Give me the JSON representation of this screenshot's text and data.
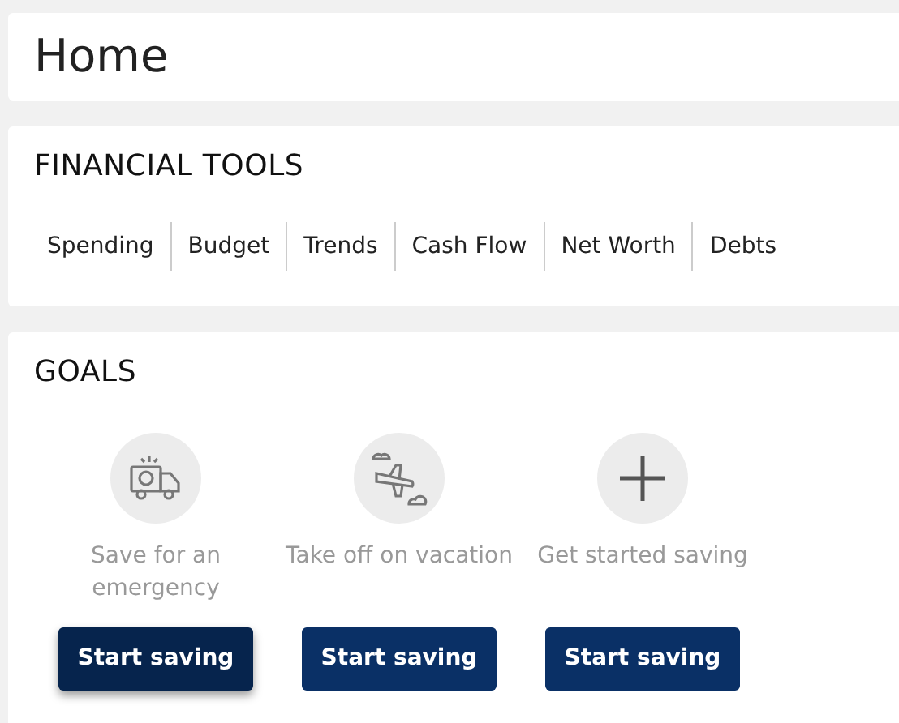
{
  "page_title": "Home",
  "financial_tools": {
    "title": "FINANCIAL TOOLS",
    "links": [
      {
        "label": "Spending"
      },
      {
        "label": "Budget"
      },
      {
        "label": "Trends"
      },
      {
        "label": "Cash Flow"
      },
      {
        "label": "Net Worth"
      },
      {
        "label": "Debts"
      }
    ]
  },
  "goals": {
    "title": "GOALS",
    "items": [
      {
        "kind": "emergency",
        "label": "Save for an emergency",
        "button": "Start saving",
        "hovered": true
      },
      {
        "kind": "vacation",
        "label": "Take off on vacation",
        "button": "Start saving",
        "hovered": false
      },
      {
        "kind": "add",
        "label": "Get started saving",
        "button": "Start saving",
        "hovered": false
      }
    ]
  }
}
